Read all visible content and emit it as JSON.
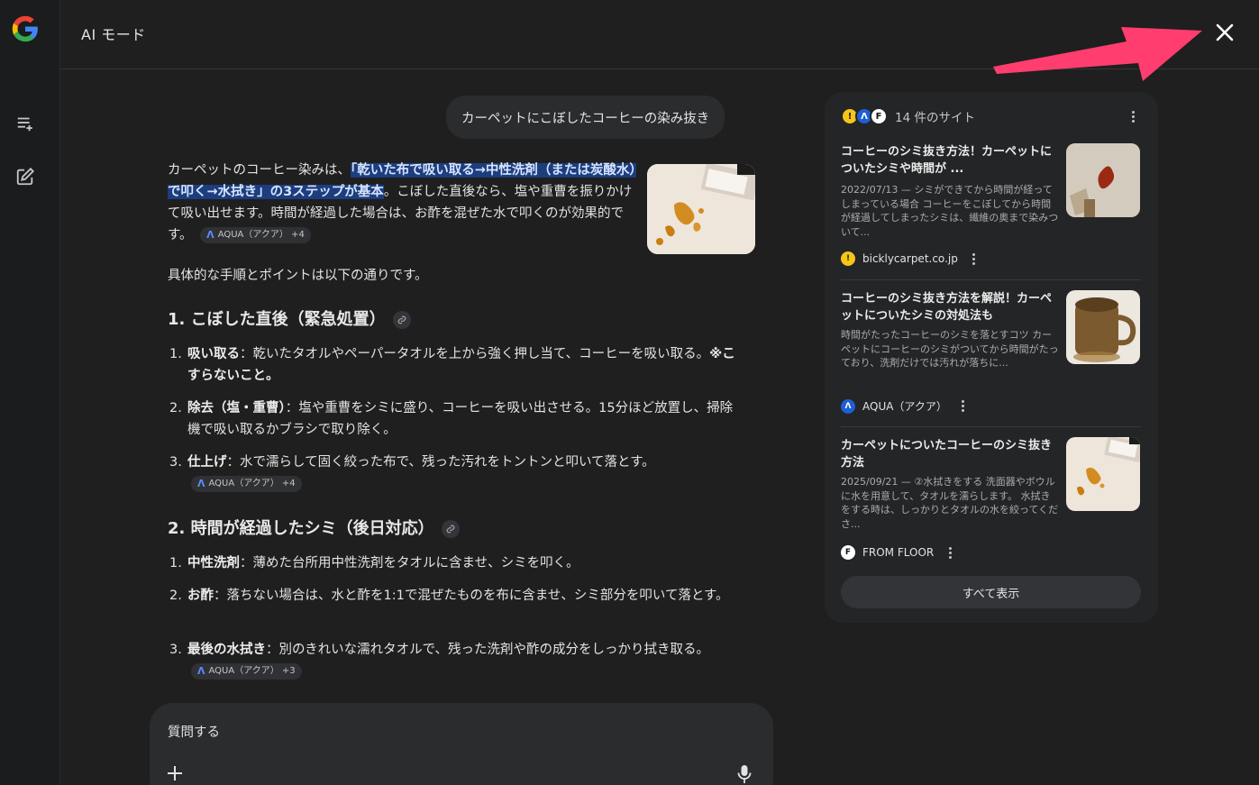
{
  "header": {
    "title": "AI モード"
  },
  "query": "カーペットにこぼしたコーヒーの染み抜き",
  "answer": {
    "intro_before": "カーペットのコーヒー染みは、",
    "intro_highlight": "「乾いた布で吸い取る→中性洗剤（または炭酸水）で叩く→水拭き」の3ステップが基本",
    "intro_after": "。こぼした直後なら、塩や重曹を振りかけて吸い出せます。時間が経過した場合は、お酢を混ぜた水で叩くのが効果的です。",
    "intro_chip": "AQUA（アクア） +4",
    "para2": "具体的な手順とポイントは以下の通りです。",
    "section1": {
      "heading": "1. こぼした直後（緊急処置）",
      "items": [
        {
          "num": "1.",
          "bold": "吸い取る",
          "text": "：乾いたタオルやペーパータオルを上から強く押し当て、コーヒーを吸い取る。",
          "bold2": "※こすらないこと。"
        },
        {
          "num": "2.",
          "bold": "除去（塩・重曹）",
          "text": "：塩や重曹をシミに盛り、コーヒーを吸い出させる。15分ほど放置し、掃除機で吸い取るかブラシで取り除く。"
        },
        {
          "num": "3.",
          "bold": "仕上げ",
          "text": "：水で濡らして固く絞った布で、残った汚れをトントンと叩いて落とす。",
          "chip": "AQUA（アクア） +4"
        }
      ]
    },
    "section2": {
      "heading": "2. 時間が経過したシミ（後日対応）",
      "items": [
        {
          "num": "1.",
          "bold": "中性洗剤",
          "text": "：薄めた台所用中性洗剤をタオルに含ませ、シミを叩く。"
        },
        {
          "num": "2.",
          "bold": "お酢",
          "text": "：落ちない場合は、水と酢を1:1で混ぜたものを布に含ませ、シミ部分を叩いて落とす。"
        },
        {
          "num": "3.",
          "bold": "最後の水拭き",
          "text": "：別のきれいな濡れタオルで、残った洗剤や酢の成分をしっかり拭き取る。",
          "chip": "AQUA（アクア） +3"
        }
      ]
    }
  },
  "ask": {
    "placeholder": "質問する"
  },
  "sources": {
    "title": "14 件のサイト",
    "show_all": "すべて表示",
    "cards": [
      {
        "title": "コーヒーのシミ抜き方法！カーペットについたシミや時間が ...",
        "desc": "2022/07/13 — シミができてから時間が経ってしまっている場合 コーヒーをこぼしてから時間が経過してしまったシミは、繊維の奥まで染みついて...",
        "site": "bicklycarpet.co.jp"
      },
      {
        "title": "コーヒーのシミ抜き方法を解説！カーペットについたシミの対処法も",
        "desc": "時間がたったコーヒーのシミを落とすコツ カーペットにコーヒーのシミがついてから時間がたっており、洗剤だけでは汚れが落ちに...",
        "site": "AQUA（アクア）"
      },
      {
        "title": "カーペットについたコーヒーのシミ抜き方法",
        "desc": "2025/09/21 — ②水拭きをする 洗面器やボウルに水を用意して、タオルを濡らします。 水拭きをする時は、しっかりとタオルの水を絞ってくださ...",
        "site": "FROM FLOOR"
      }
    ]
  },
  "colors": {
    "background": "#1f1f1f",
    "highlight": "#1c3d7e",
    "arrow": "#ff3d6e"
  }
}
